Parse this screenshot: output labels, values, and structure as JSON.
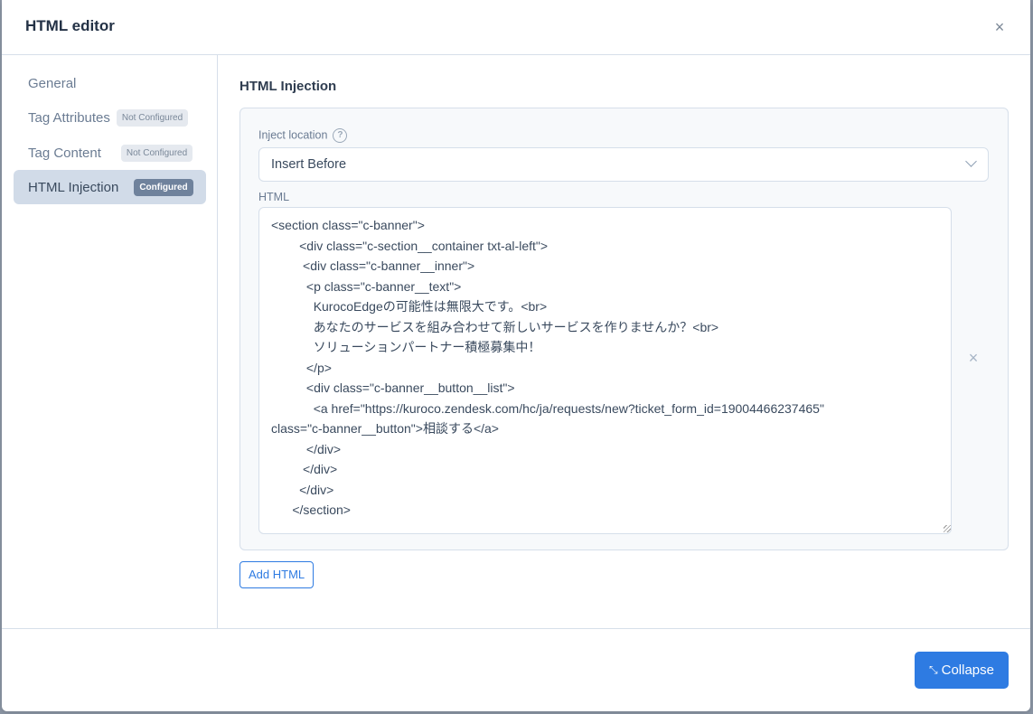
{
  "modal": {
    "title": "HTML editor",
    "close_icon": "×"
  },
  "sidebar": {
    "items": [
      {
        "label": "General",
        "badge": null
      },
      {
        "label": "Tag Attributes",
        "badge": "Not Configured"
      },
      {
        "label": "Tag Content",
        "badge": "Not Configured"
      },
      {
        "label": "HTML Injection",
        "badge": "Configured",
        "active": true
      }
    ]
  },
  "main": {
    "section_title": "HTML Injection",
    "inject_location_label": "Inject location",
    "help_icon": "?",
    "inject_location_value": "Insert Before",
    "html_label": "HTML",
    "html_value": "<section class=\"c-banner\">\n        <div class=\"c-section__container txt-al-left\">\n         <div class=\"c-banner__inner\">\n          <p class=\"c-banner__text\">\n            KurocoEdgeの可能性は無限大です。<br>\n            あなたのサービスを組み合わせて新しいサービスを作りませんか？<br>\n            ソリューションパートナー積極募集中！\n          </p>\n          <div class=\"c-banner__button__list\">\n            <a href=\"https://kuroco.zendesk.com/hc/ja/requests/new?ticket_form_id=19004466237465\"\nclass=\"c-banner__button\">相談する</a>\n          </div>\n         </div>\n        </div>\n      </section>",
    "remove_icon": "×",
    "add_html_label": "Add HTML"
  },
  "footer": {
    "collapse_label": "Collapse",
    "collapse_icon": "⤡"
  },
  "colors": {
    "primary": "#2e7be2",
    "active_nav_bg": "#d1dbe8",
    "configured_badge": "#6f829c"
  }
}
